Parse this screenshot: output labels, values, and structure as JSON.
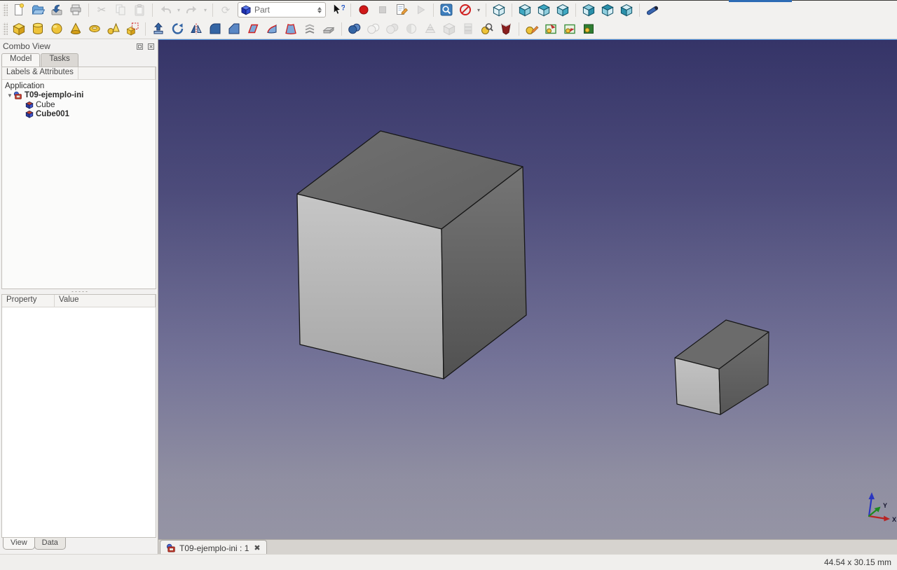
{
  "colors": {
    "viewport_gradient_top": "#343367",
    "viewport_gradient_bottom": "#9b9aa8",
    "freecad_yellow": "#eec339",
    "view_cube_teal": "#3fa8c2",
    "accent_blue": "#3465a4",
    "record_red": "#d01818",
    "top_strip": "#3b3a36"
  },
  "workbench_selector": {
    "value": "Part"
  },
  "toolbar_main": {
    "items": [
      {
        "type": "grip"
      },
      {
        "name": "new-file",
        "icon": "page"
      },
      {
        "name": "open-file",
        "icon": "folder"
      },
      {
        "name": "save-file",
        "icon": "save"
      },
      {
        "name": "print",
        "icon": "printer"
      },
      {
        "type": "sep"
      },
      {
        "name": "cut",
        "icon": "scissors",
        "disabled": true
      },
      {
        "name": "copy",
        "icon": "copy",
        "disabled": true
      },
      {
        "name": "paste",
        "icon": "clipboard",
        "disabled": true
      },
      {
        "type": "sep"
      },
      {
        "name": "undo",
        "icon": "undo",
        "disabled": true,
        "caret": true
      },
      {
        "name": "redo",
        "icon": "redo",
        "disabled": true,
        "caret": true
      },
      {
        "type": "sep"
      },
      {
        "name": "refresh",
        "icon": "refresh",
        "disabled": true
      },
      {
        "type": "workbench"
      },
      {
        "name": "whats-this",
        "icon": "cursorhelp"
      },
      {
        "type": "sep"
      },
      {
        "name": "macro-record",
        "icon": "record"
      },
      {
        "name": "macro-stop",
        "icon": "stop",
        "disabled": true
      },
      {
        "name": "macro-edit",
        "icon": "macroedit"
      },
      {
        "name": "macro-play",
        "icon": "play",
        "disabled": true
      },
      {
        "type": "sep"
      },
      {
        "name": "view-fit-all",
        "icon": "zoomfit"
      },
      {
        "name": "draw-style",
        "icon": "drawstyle",
        "caret": true
      },
      {
        "type": "sep"
      },
      {
        "name": "view-isometric",
        "icon": "cubeiso"
      },
      {
        "type": "sep"
      },
      {
        "name": "view-front",
        "icon": "cubefront"
      },
      {
        "name": "view-top",
        "icon": "cubetop"
      },
      {
        "name": "view-right",
        "icon": "cuberight"
      },
      {
        "type": "sep"
      },
      {
        "name": "view-rear",
        "icon": "cuberear"
      },
      {
        "name": "view-bottom",
        "icon": "cubebottom"
      },
      {
        "name": "view-left",
        "icon": "cubeleft"
      },
      {
        "type": "sep"
      },
      {
        "name": "measure-distance",
        "icon": "measure"
      }
    ]
  },
  "toolbar_part": {
    "items": [
      {
        "type": "grip"
      },
      {
        "name": "part-box",
        "icon": "boxyellow"
      },
      {
        "name": "part-cylinder",
        "icon": "cylinder"
      },
      {
        "name": "part-sphere",
        "icon": "sphereyellow"
      },
      {
        "name": "part-cone",
        "icon": "cone"
      },
      {
        "name": "part-torus",
        "icon": "torus"
      },
      {
        "name": "part-primitives",
        "icon": "primitives"
      },
      {
        "name": "part-shape-builder",
        "icon": "shapebuilder"
      },
      {
        "type": "sep"
      },
      {
        "name": "part-extrude",
        "icon": "extrude"
      },
      {
        "name": "part-revolve",
        "icon": "revolve"
      },
      {
        "name": "part-mirror",
        "icon": "mirror"
      },
      {
        "name": "part-fillet",
        "icon": "fillet"
      },
      {
        "name": "part-chamfer",
        "icon": "chamfer"
      },
      {
        "name": "part-make-face",
        "icon": "makeface"
      },
      {
        "name": "part-ruled-surface",
        "icon": "ruled"
      },
      {
        "name": "part-loft",
        "icon": "loft"
      },
      {
        "name": "part-sweep",
        "icon": "sweep"
      },
      {
        "name": "part-offset",
        "icon": "offset"
      },
      {
        "type": "sep"
      },
      {
        "name": "part-boolean-union",
        "icon": "union"
      },
      {
        "name": "part-boolean-cut",
        "icon": "cut2",
        "disabled": true
      },
      {
        "name": "part-boolean-common",
        "icon": "common",
        "disabled": true
      },
      {
        "name": "part-section",
        "icon": "section",
        "disabled": true
      },
      {
        "name": "part-cross-sections",
        "icon": "xsections",
        "disabled": true
      },
      {
        "name": "part-compound",
        "icon": "compound",
        "disabled": true
      },
      {
        "name": "part-compsolid",
        "icon": "compsolid",
        "disabled": true
      },
      {
        "name": "part-check-geometry",
        "icon": "checkgeom"
      },
      {
        "name": "part-defeaturing",
        "icon": "defeature"
      },
      {
        "type": "sep"
      },
      {
        "name": "sketch-edit",
        "icon": "sketchedit"
      },
      {
        "name": "sketch-map-to-face",
        "icon": "greenarrow1"
      },
      {
        "name": "sketch-reorient",
        "icon": "greenarrow2"
      },
      {
        "name": "sketch-validate",
        "icon": "greenbox"
      }
    ]
  },
  "combo_view": {
    "title": "Combo View",
    "tabs": [
      {
        "label": "Model",
        "active": true
      },
      {
        "label": "Tasks",
        "active": false
      }
    ],
    "tree_header": "Labels & Attributes",
    "tree": {
      "root": "Application",
      "document": {
        "label": "T09-ejemplo-ini",
        "children": [
          {
            "label": "Cube",
            "bold": false
          },
          {
            "label": "Cube001",
            "bold": true
          }
        ]
      }
    },
    "property_table": {
      "columns": [
        "Property",
        "Value"
      ],
      "rows": []
    },
    "bottom_tabs": [
      {
        "label": "View",
        "active": true
      },
      {
        "label": "Data",
        "active": false
      }
    ]
  },
  "viewport": {
    "mdi_tab": {
      "label": "T09-ejemplo-ini : 1",
      "close_glyph": "✖"
    },
    "axis": {
      "x_label": "X",
      "y_label": "Y"
    },
    "objects": [
      {
        "name": "Cube",
        "shape": "large box"
      },
      {
        "name": "Cube001",
        "shape": "small box"
      }
    ]
  },
  "status_bar": {
    "dimensions": "44.54 x 30.15 mm"
  }
}
